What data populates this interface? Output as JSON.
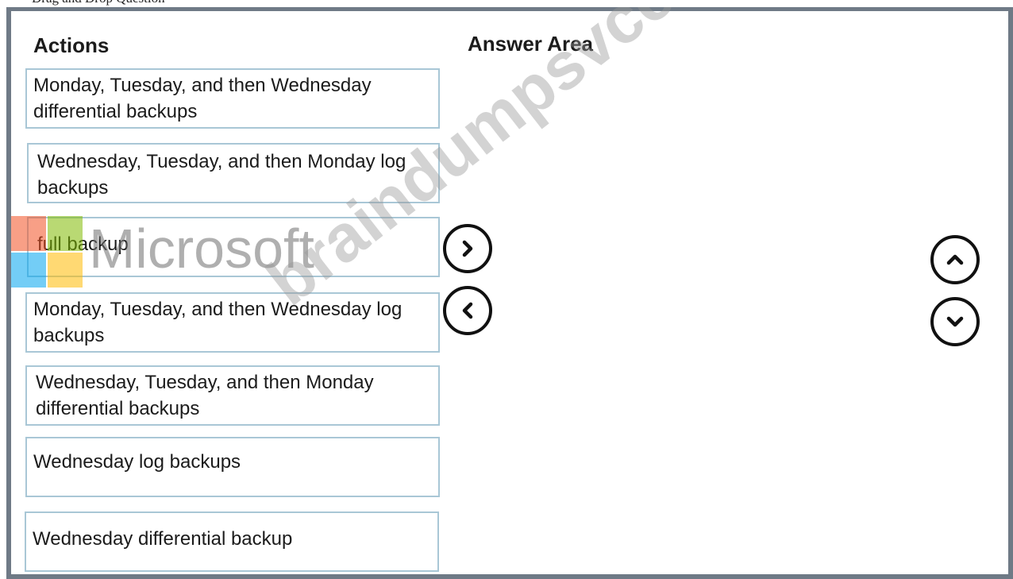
{
  "top_caption": "Drag and Drop Question",
  "actions": {
    "heading": "Actions",
    "items": [
      {
        "text": "Monday, Tuesday, and then Wednesday differential backups"
      },
      {
        "text": "Wednesday, Tuesday, and then Monday log backups"
      },
      {
        "text": "full backup"
      },
      {
        "text": "Monday, Tuesday, and then Wednesday log backups"
      },
      {
        "text": "Wednesday, Tuesday, and then Monday differential backups"
      },
      {
        "text": "Wednesday log backups"
      },
      {
        "text": "Wednesday differential backup"
      }
    ]
  },
  "answer_area": {
    "heading": "Answer Area"
  },
  "controls": {
    "move_right_icon": "chevron-right-icon",
    "move_left_icon": "chevron-left-icon",
    "move_up_icon": "chevron-up-icon",
    "move_down_icon": "chevron-down-icon"
  },
  "watermarks": {
    "logo_text": "Microsoft",
    "site_text": "braindumpsvce.com",
    "logo_colors": [
      "#f25022",
      "#7fba00",
      "#00a4ef",
      "#ffb900"
    ]
  }
}
